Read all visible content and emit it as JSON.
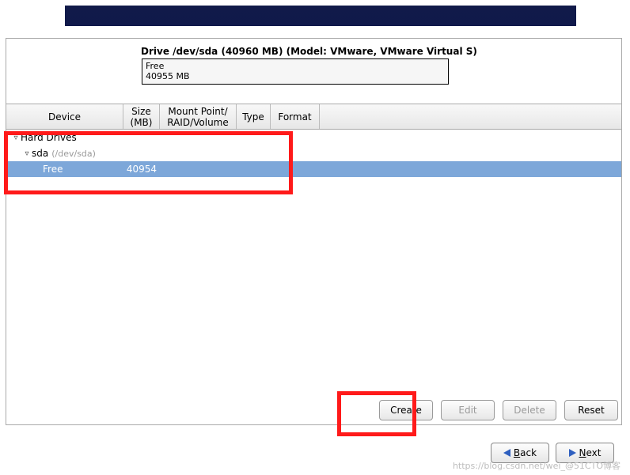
{
  "drive": {
    "title": "Drive /dev/sda (40960 MB) (Model: VMware, VMware Virtual S)",
    "box_line1": "Free",
    "box_line2": "40955 MB"
  },
  "columns": {
    "device": "Device",
    "size": "Size\n(MB)",
    "mount": "Mount Point/\nRAID/Volume",
    "type": "Type",
    "format": "Format"
  },
  "tree": {
    "hard_drives": "Hard Drives",
    "sda_label": "sda",
    "sda_path": "(/dev/sda)",
    "free_label": "Free",
    "free_size": "40954"
  },
  "buttons": {
    "create": "Create",
    "edit": "Edit",
    "delete": "Delete",
    "reset": "Reset",
    "back": "Back",
    "next": "Next"
  },
  "watermark": "https://blog.csdn.net/wei_@51CTO博客"
}
